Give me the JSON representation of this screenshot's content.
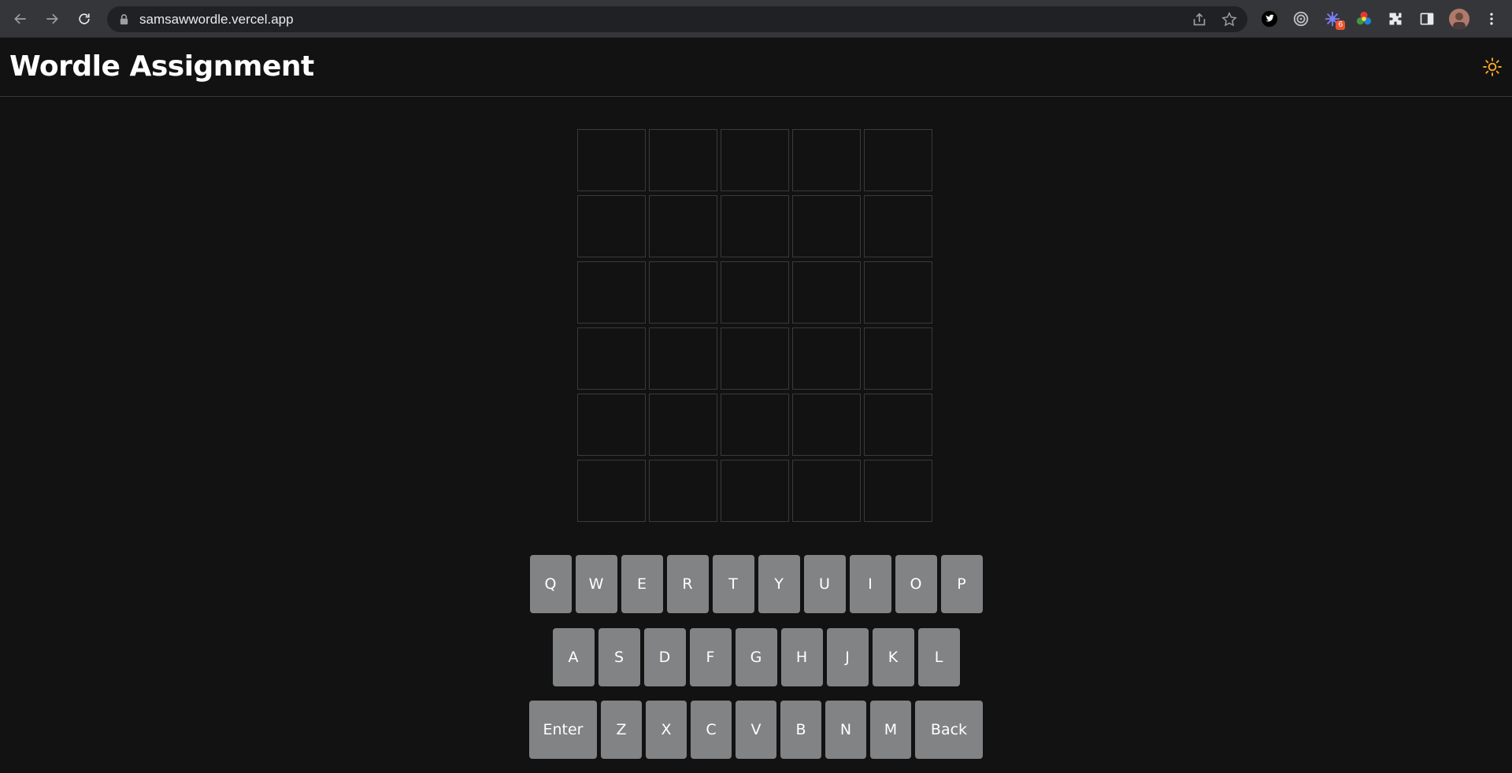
{
  "browser": {
    "url": "samsawwordle.vercel.app",
    "extension_badge": "6"
  },
  "header": {
    "title": "Wordle Assignment"
  },
  "board": {
    "rows": [
      [
        "",
        "",
        "",
        "",
        ""
      ],
      [
        "",
        "",
        "",
        "",
        ""
      ],
      [
        "",
        "",
        "",
        "",
        ""
      ],
      [
        "",
        "",
        "",
        "",
        ""
      ],
      [
        "",
        "",
        "",
        "",
        ""
      ],
      [
        "",
        "",
        "",
        "",
        ""
      ]
    ]
  },
  "keyboard": {
    "row1": [
      "Q",
      "W",
      "E",
      "R",
      "T",
      "Y",
      "U",
      "I",
      "O",
      "P"
    ],
    "row2": [
      "A",
      "S",
      "D",
      "F",
      "G",
      "H",
      "J",
      "K",
      "L"
    ],
    "row3": [
      "Enter",
      "Z",
      "X",
      "C",
      "V",
      "B",
      "N",
      "M",
      "Back"
    ]
  },
  "colors": {
    "background": "#121212",
    "tile_border": "#3a3a3c",
    "key": "#818384",
    "theme_icon": "#f5a623"
  },
  "icons": {
    "theme_toggle": "sun-icon"
  }
}
